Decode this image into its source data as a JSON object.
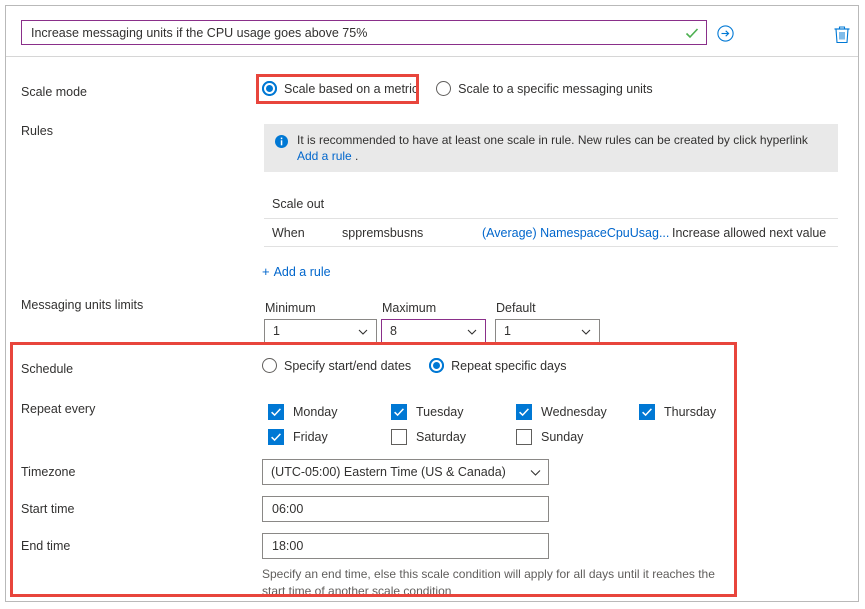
{
  "condition": {
    "name_value": "Increase messaging units if the CPU usage goes above 75%",
    "check_icon": "checkmark-icon",
    "run_icon": "arrow-circle-right-icon",
    "delete_icon": "trash-icon"
  },
  "scale_mode": {
    "label": "Scale mode",
    "options": [
      {
        "label": "Scale based on a metric",
        "selected": true
      },
      {
        "label": "Scale to a specific messaging units",
        "selected": false
      }
    ]
  },
  "rules": {
    "label": "Rules",
    "info_icon": "info-icon",
    "info_text_part1": "It is recommended to have at least one scale in rule. New rules can be created by click hyperlink ",
    "info_link": "Add a rule",
    "info_text_part2": " .",
    "table": {
      "section_title": "Scale out",
      "rows": [
        {
          "when": "When",
          "resource": "sppremsbusns",
          "metric": "(Average) NamespaceCpuUsag...",
          "action": "Increase allowed next value"
        }
      ]
    },
    "add_rule_plus": "+",
    "add_rule_label": "Add a rule"
  },
  "messaging_units_limits": {
    "label": "Messaging units limits",
    "minimum": {
      "label": "Minimum",
      "value": "1"
    },
    "maximum": {
      "label": "Maximum",
      "value": "8"
    },
    "default": {
      "label": "Default",
      "value": "1"
    }
  },
  "schedule": {
    "label": "Schedule",
    "options": [
      {
        "label": "Specify start/end dates",
        "selected": false
      },
      {
        "label": "Repeat specific days",
        "selected": true
      }
    ]
  },
  "repeat_every": {
    "label": "Repeat every",
    "days": [
      {
        "label": "Monday",
        "checked": true
      },
      {
        "label": "Tuesday",
        "checked": true
      },
      {
        "label": "Wednesday",
        "checked": true
      },
      {
        "label": "Thursday",
        "checked": true
      },
      {
        "label": "Friday",
        "checked": true
      },
      {
        "label": "Saturday",
        "checked": false
      },
      {
        "label": "Sunday",
        "checked": false
      }
    ]
  },
  "timezone": {
    "label": "Timezone",
    "value": "(UTC-05:00) Eastern Time (US & Canada)"
  },
  "start_time": {
    "label": "Start time",
    "value": "06:00"
  },
  "end_time": {
    "label": "End time",
    "value": "18:00"
  },
  "helper_text": "Specify an end time, else this scale condition will apply for all days until it reaches the start time of another scale condition",
  "colors": {
    "accent_blue": "#0078d4",
    "link_blue": "#0066cc",
    "annotation_red": "#e8453c",
    "purple_border": "#8a2f8a",
    "check_green": "#4caf50"
  }
}
